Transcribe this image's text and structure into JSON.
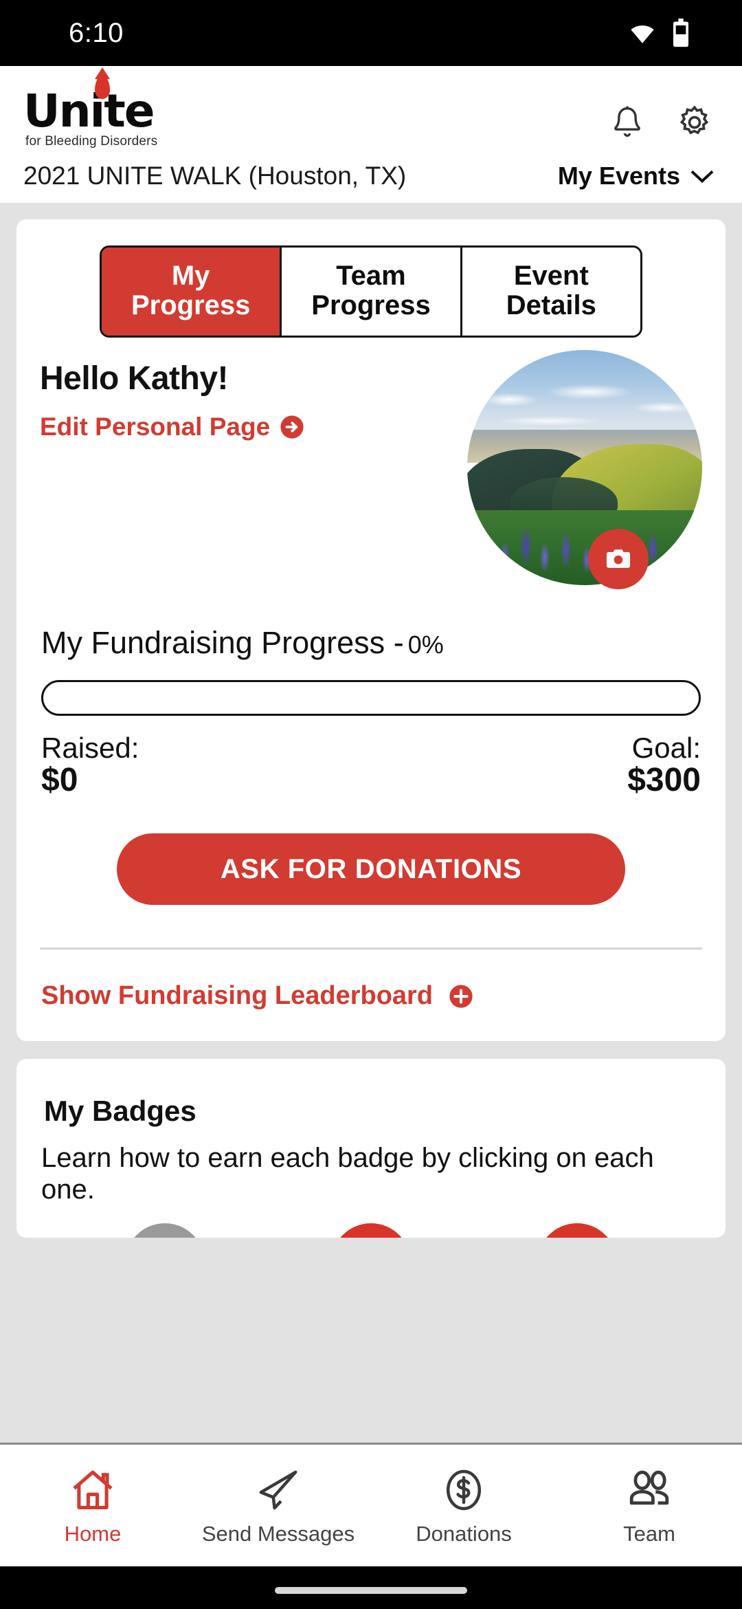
{
  "status_bar": {
    "time": "6:10",
    "wifi_icon": "wifi-icon",
    "battery_icon": "battery-icon"
  },
  "header": {
    "logo_word": "Unite",
    "logo_tagline": "for Bleeding Disorders",
    "logo_drop_icon": "blood-drop-icon",
    "notifications_icon": "bell-icon",
    "settings_icon": "gear-icon",
    "event_name": "2021 UNITE WALK (Houston, TX)",
    "my_events_label": "My Events",
    "my_events_chevron_icon": "chevron-down-icon"
  },
  "tabs": [
    {
      "label_line1": "My",
      "label_line2": "Progress",
      "active": true
    },
    {
      "label_line1": "Team",
      "label_line2": "Progress",
      "active": false
    },
    {
      "label_line1": "Event",
      "label_line2": "Details",
      "active": false
    }
  ],
  "progress_card": {
    "greeting": "Hello Kathy!",
    "edit_link_label": "Edit Personal Page",
    "edit_link_icon": "arrow-right-circle-icon",
    "avatar_alt": "profile-photo-landscape-with-lupine-flowers",
    "camera_icon": "camera-icon",
    "fundraising_title": "My Fundraising Progress -",
    "fundraising_percent": "0%",
    "progress_percent_value": 0,
    "raised_label": "Raised:",
    "raised_amount": "$0",
    "goal_label": "Goal:",
    "goal_amount": "$300",
    "ask_button_label": "ASK FOR DONATIONS",
    "leaderboard_label": "Show Fundraising Leaderboard",
    "leaderboard_icon": "plus-circle-icon"
  },
  "badges_card": {
    "title": "My Badges",
    "subtitle": "Learn how to earn each badge by clicking on each one.",
    "badges": [
      {
        "name": "badge-locked",
        "color": "#9a9a9a"
      },
      {
        "name": "badge-earned-1",
        "color": "#d8352a"
      },
      {
        "name": "badge-earned-2",
        "color": "#d8352a"
      }
    ]
  },
  "bottom_nav": [
    {
      "label": "Home",
      "icon": "home-icon",
      "active": true
    },
    {
      "label": "Send Messages",
      "icon": "paper-plane-icon",
      "active": false
    },
    {
      "label": "Donations",
      "icon": "dollar-circle-icon",
      "active": false
    },
    {
      "label": "Team",
      "icon": "people-icon",
      "active": false
    }
  ],
  "colors": {
    "brand_red": "#d13b32",
    "logo_red": "#d8352a",
    "background": "#e2e2e2",
    "card": "#ffffff",
    "text": "#111111"
  }
}
